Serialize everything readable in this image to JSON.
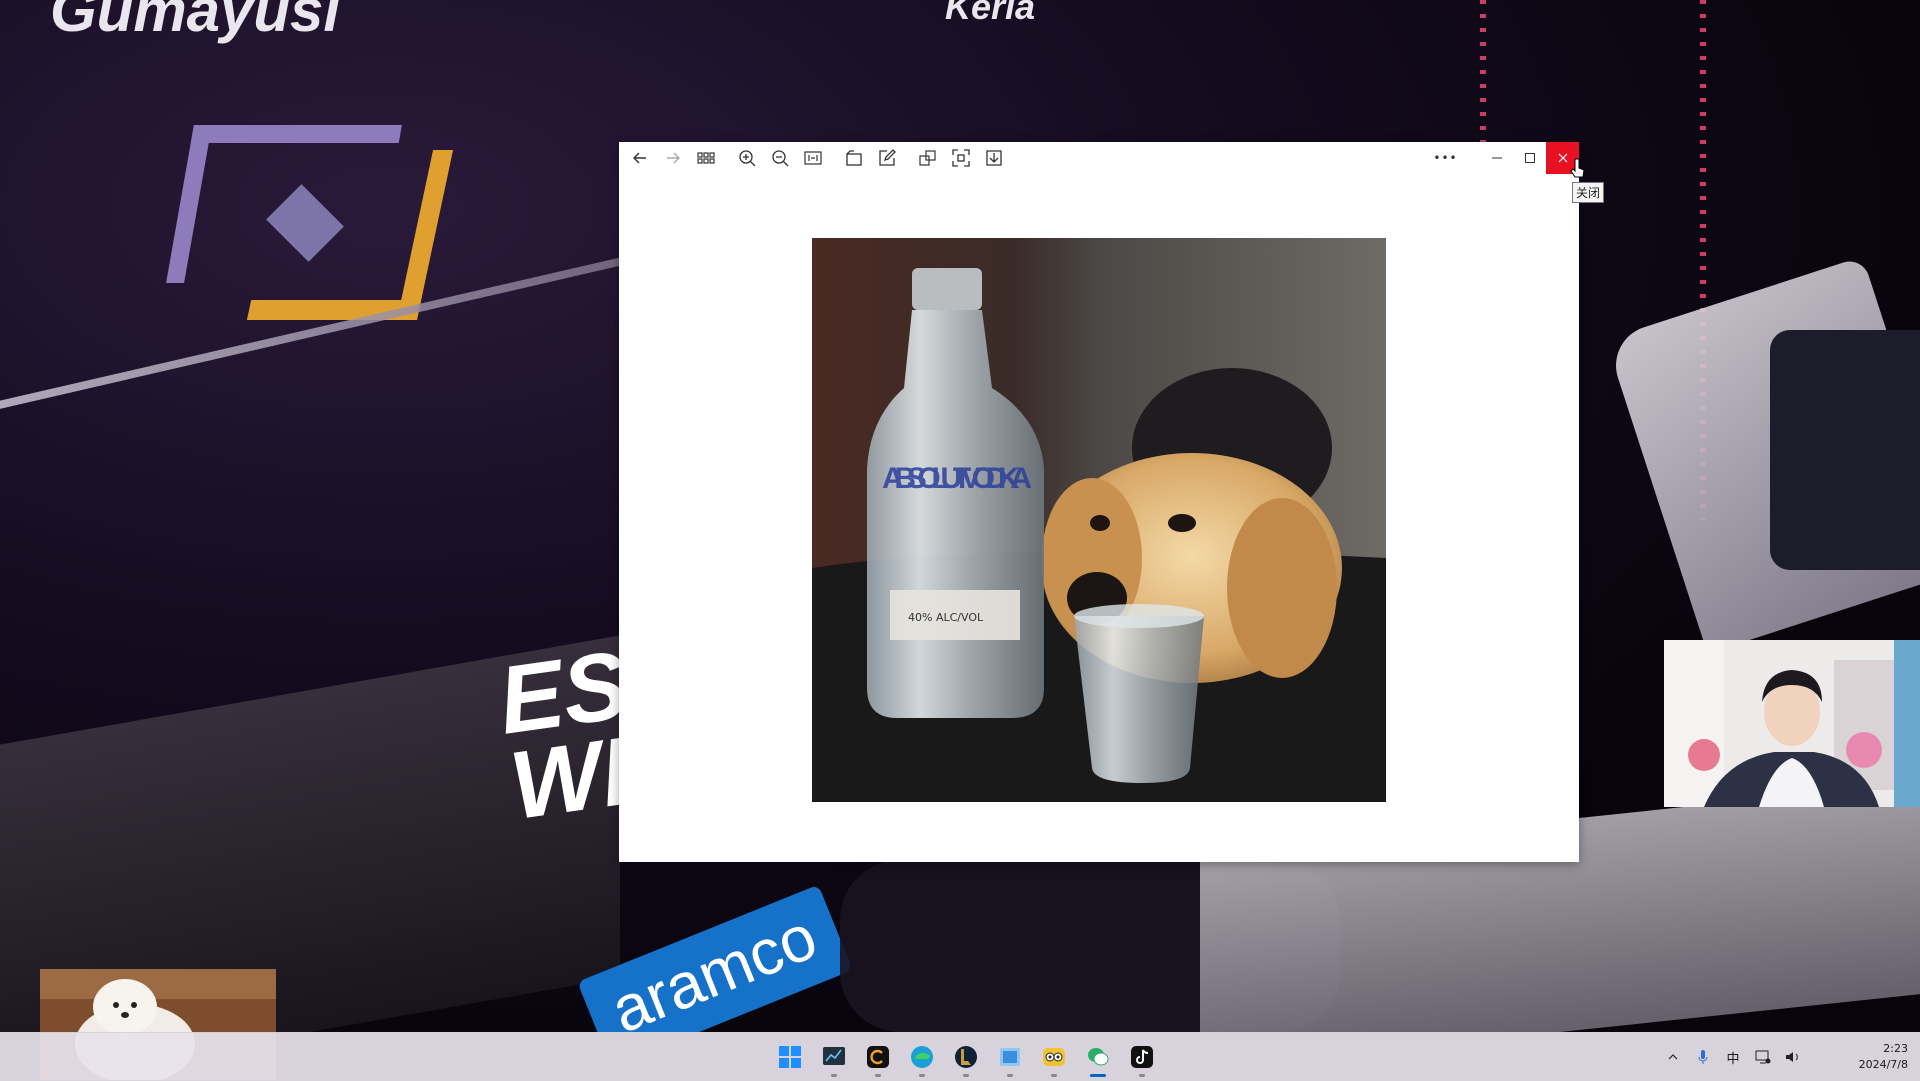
{
  "background": {
    "top_text_left": "Gumayusi",
    "top_text_center": "Keria",
    "side_text": "ES\nWI",
    "sponsor_text": "aramco"
  },
  "viewer": {
    "toolbar_icons": [
      "back-arrow-icon",
      "forward-arrow-icon",
      "thumbnail-grid-icon",
      "zoom-in-icon",
      "zoom-out-icon",
      "fit-to-window-icon",
      "rotate-icon",
      "edit-icon",
      "open-with-icon",
      "fullscreen-icon",
      "save-as-icon"
    ],
    "more_label": "•••",
    "photo_label_text": "40% ALC/VOL",
    "photo_brand_text": "ABSOLUT VODKA",
    "close_tooltip": "关闭"
  },
  "taskbar": {
    "apps": [
      {
        "name": "start-button",
        "color": "#1f8fff"
      },
      {
        "name": "app-monitor",
        "color": "#22303d"
      },
      {
        "name": "app-c",
        "color": "#111111"
      },
      {
        "name": "app-edge",
        "color": "#1a9fd6"
      },
      {
        "name": "app-league",
        "color": "#c89b3c"
      },
      {
        "name": "app-files",
        "color": "#3b8de0"
      },
      {
        "name": "app-owl",
        "color": "#f1c232"
      },
      {
        "name": "app-wechat",
        "color": "#2aae67"
      },
      {
        "name": "app-tiktok",
        "color": "#111111"
      }
    ],
    "tray_ime": "中",
    "clock_time": "2:23",
    "clock_date": "2024/7/8"
  }
}
